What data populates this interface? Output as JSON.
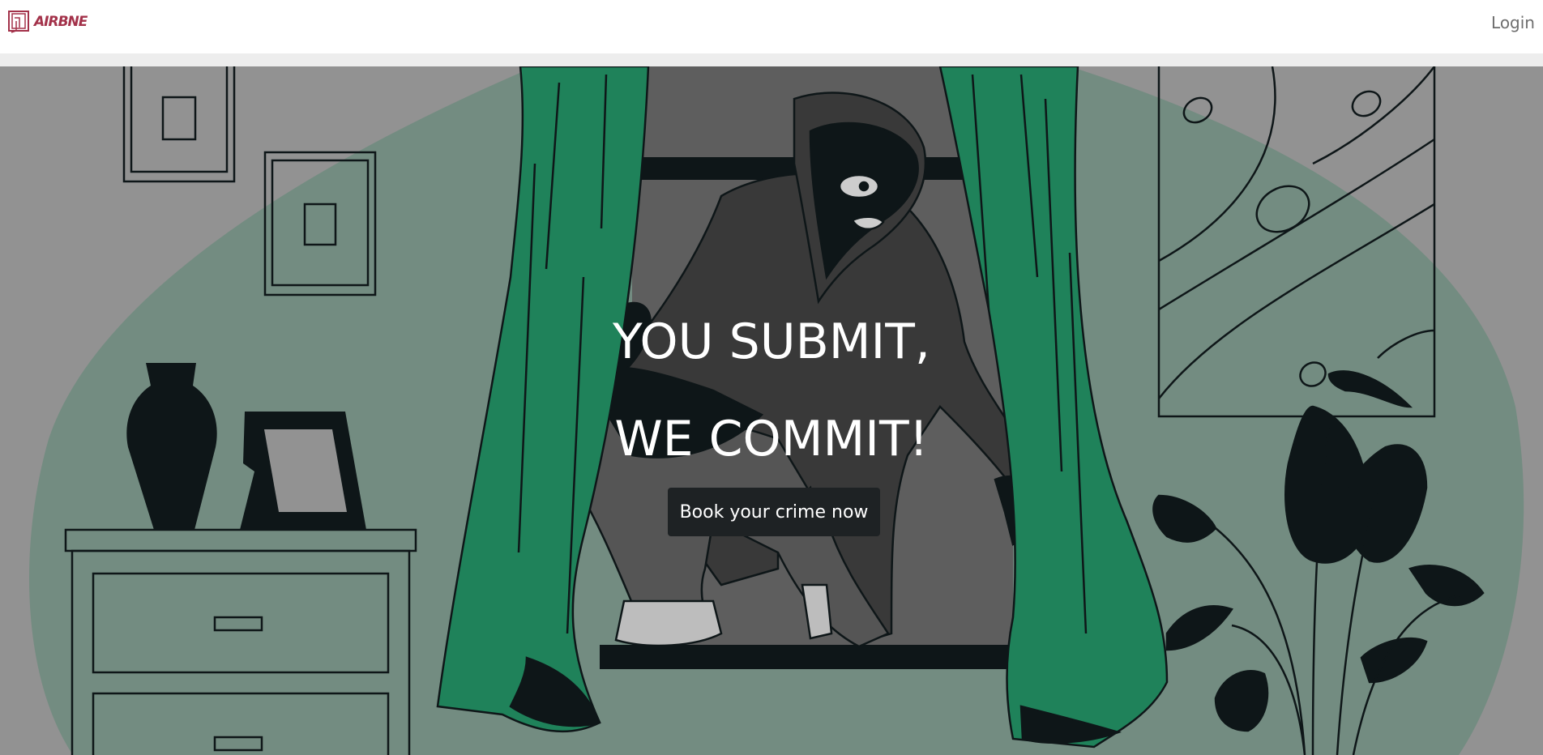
{
  "navbar": {
    "logo_text": "AIRBNE",
    "login_label": "Login"
  },
  "hero": {
    "headline_line1": "YOU SUBMIT,",
    "headline_line2": "WE COMMIT!",
    "cta_label": "Book your crime now"
  },
  "colors": {
    "brand": "#a3324a",
    "curtain": "#21895f",
    "blob": "#7a9488",
    "background": "#9a9a9a",
    "dark": "#0f181a",
    "button": "#1e2224"
  }
}
